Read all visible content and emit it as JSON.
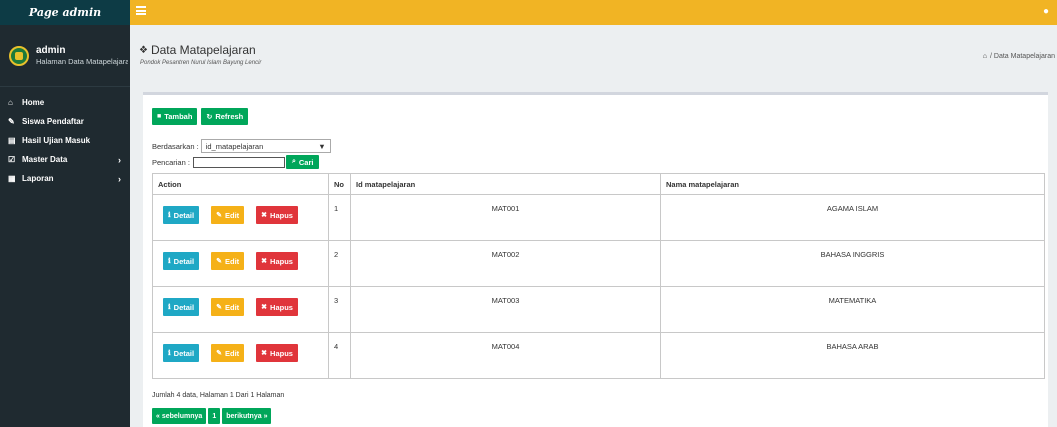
{
  "sidebar": {
    "brand": "Page admin",
    "user": {
      "name": "admin",
      "subtitle": "Halaman Data Matapelajaran"
    },
    "items": [
      {
        "label": "Home",
        "icon": "home-icon",
        "glyph": "⌂"
      },
      {
        "label": "Siswa Pendaftar",
        "icon": "pencil-icon",
        "glyph": "✎"
      },
      {
        "label": "Hasil Ujian Masuk",
        "icon": "book-icon",
        "glyph": "▤"
      },
      {
        "label": "Master Data",
        "icon": "edit-icon",
        "glyph": "☑",
        "has_children": true
      },
      {
        "label": "Laporan",
        "icon": "calendar-icon",
        "glyph": "▦",
        "has_children": true
      }
    ]
  },
  "header": {
    "menu_icon": "hamburger-icon",
    "user_icon": "user-icon"
  },
  "page": {
    "title": "Data Matapelajaran",
    "subtitle": "Pondok Pesantren Nurul Islam Bayung Lencir",
    "breadcrumb": {
      "current": "Data Matapelajaran"
    }
  },
  "toolbar": {
    "add_label": "Tambah",
    "refresh_label": "Refresh"
  },
  "filter": {
    "by_label": "Berdasarkan :",
    "by_value": "id_matapelajaran",
    "search_label": "Pencarian   :",
    "search_value": "",
    "search_button": "Cari"
  },
  "table": {
    "headers": [
      "Action",
      "No",
      "Id matapelajaran",
      "Nama matapelajaran"
    ],
    "action_labels": {
      "detail": "Detail",
      "edit": "Edit",
      "delete": "Hapus"
    },
    "rows": [
      {
        "no": "1",
        "id": "MAT001",
        "nama": "AGAMA ISLAM"
      },
      {
        "no": "2",
        "id": "MAT002",
        "nama": "BAHASA INGGRIS"
      },
      {
        "no": "3",
        "id": "MAT003",
        "nama": "MATEMATIKA"
      },
      {
        "no": "4",
        "id": "MAT004",
        "nama": "BAHASA ARAB"
      }
    ]
  },
  "summary": "Jumlah 4 data, Halaman 1 Dari 1 Halaman",
  "pagination": {
    "prev": "« sebelumnya",
    "current": "1",
    "next": "berikutnya »"
  },
  "colors": {
    "topbar": "#f1b424",
    "sidebar": "#1f2a30",
    "green": "#00a65a",
    "blue": "#1fa8c5",
    "yellow": "#f5b118",
    "red": "#e0353b"
  }
}
